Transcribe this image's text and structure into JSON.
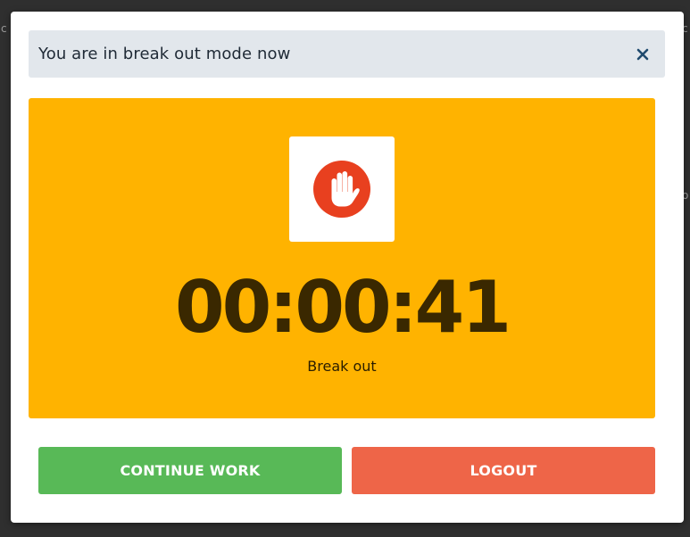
{
  "background_fragments": [
    "c",
    "c",
    "o"
  ],
  "dialog": {
    "title": "You are in break out mode now",
    "close_icon": "close-icon",
    "status_icon": "stop-hand-icon",
    "timer": "00:00:41",
    "status_label": "Break out",
    "continue_label": "CONTINUE WORK",
    "logout_label": "LOGOUT"
  },
  "colors": {
    "panel": "#ffb300",
    "header": "#e2e7ec",
    "continue": "#58b957",
    "logout": "#ee6548",
    "icon_circle": "#e8401f",
    "close": "#1f4a6e",
    "timer_text": "#3a2800"
  }
}
